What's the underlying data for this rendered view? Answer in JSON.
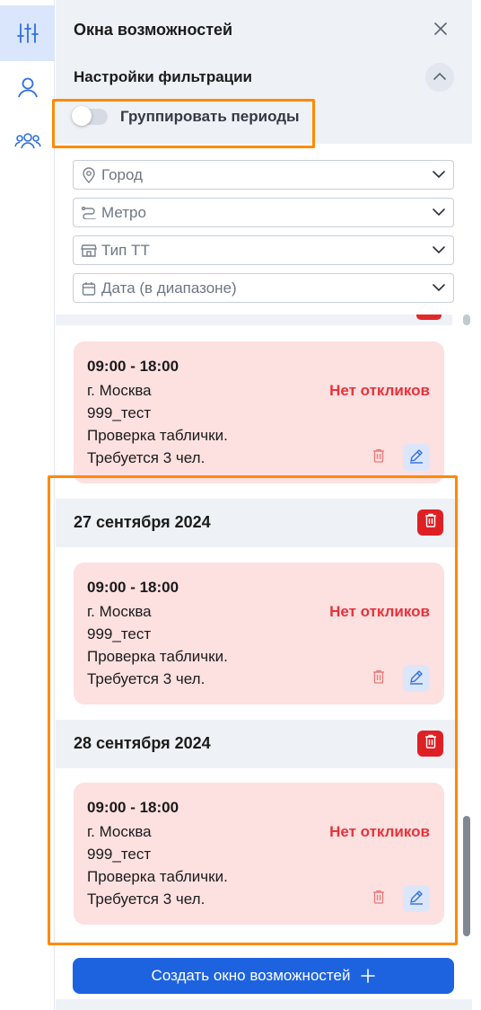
{
  "rail": {
    "items": [
      {
        "name": "filters",
        "icon": "sliders-icon",
        "active": true
      },
      {
        "name": "profile",
        "icon": "user-icon",
        "active": false
      },
      {
        "name": "team",
        "icon": "users-icon",
        "active": false
      }
    ]
  },
  "panel": {
    "title": "Окна возможностей",
    "close_icon": "close-icon"
  },
  "filters": {
    "title": "Настройки фильтрации",
    "group_toggle_label": "Группировать периоды",
    "group_toggle_on": false,
    "fields": [
      {
        "placeholder": "Город",
        "icon": "location-pin-icon"
      },
      {
        "placeholder": "Метро",
        "icon": "route-icon"
      },
      {
        "placeholder": "Тип ТТ",
        "icon": "store-icon"
      },
      {
        "placeholder": "Дата (в диапазоне)",
        "icon": "calendar-icon"
      }
    ]
  },
  "list": {
    "groups": [
      {
        "date": "",
        "card": {
          "time": "09:00 - 18:00",
          "city": "г. Москва",
          "code": "999_тест",
          "description": "Проверка таблички.",
          "need": "Требуется 3 чел.",
          "status": "Нет откликов"
        }
      },
      {
        "date": "27 сентября 2024",
        "card": {
          "time": "09:00 - 18:00",
          "city": "г. Москва",
          "code": "999_тест",
          "description": "Проверка таблички.",
          "need": "Требуется 3 чел.",
          "status": "Нет откликов"
        }
      },
      {
        "date": "28 сентября 2024",
        "card": {
          "time": "09:00 - 18:00",
          "city": "г. Москва",
          "code": "999_тест",
          "description": "Проверка таблички.",
          "need": "Требуется 3 чел.",
          "status": "Нет откликов"
        }
      }
    ]
  },
  "create_button_label": "Создать окно возможностей",
  "colors": {
    "accent": "#1d63e0",
    "danger": "#de2025",
    "status_text": "#e6333b",
    "card_bg": "#fde0e0",
    "highlight": "#ff8a00"
  }
}
